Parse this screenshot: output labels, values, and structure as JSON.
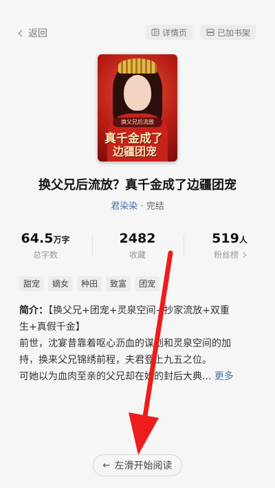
{
  "topbar": {
    "back_label": "返回",
    "detail_label": "详情页",
    "shelf_label": "已加书架"
  },
  "book": {
    "cover_subtitle": "换父兄后流放",
    "cover_title_line1": "真千金成了",
    "cover_title_line2": "边疆团宠",
    "title": "换父兄后流放？真千金成了边疆团宠",
    "author": "君染染",
    "separator": " · ",
    "status": "完结"
  },
  "stats": [
    {
      "value": "64.5",
      "unit": "万字",
      "label": "总字数"
    },
    {
      "value": "2482",
      "unit": "",
      "label": "收藏"
    },
    {
      "value": "519",
      "unit": "人",
      "label": "粉丝榜"
    }
  ],
  "tags": [
    "甜宠",
    "嫡女",
    "种田",
    "致富",
    "团宠"
  ],
  "intro": {
    "label": "简介：",
    "line1": "【换父兄+团宠+灵泉空间+抄家流放+双重",
    "line2": "生+真假千金】",
    "line3": "前世，沈宴昔靠着呕心沥血的谋划和灵泉空间的加",
    "line4": "持，换来父兄锦绣前程，夫君登上九五之位。",
    "line5": "可她以为血肉至亲的父兄却在她的封后大典...",
    "more": "更多"
  },
  "read_button": {
    "label": "左滑开始阅读"
  },
  "colors": {
    "accent": "#4a6ea8",
    "annotation_arrow": "#ee1c1c"
  },
  "icons": [
    "chevron-left-icon",
    "detail-page-icon",
    "bookshelf-icon",
    "chevron-right-icon",
    "arrow-left-icon"
  ]
}
